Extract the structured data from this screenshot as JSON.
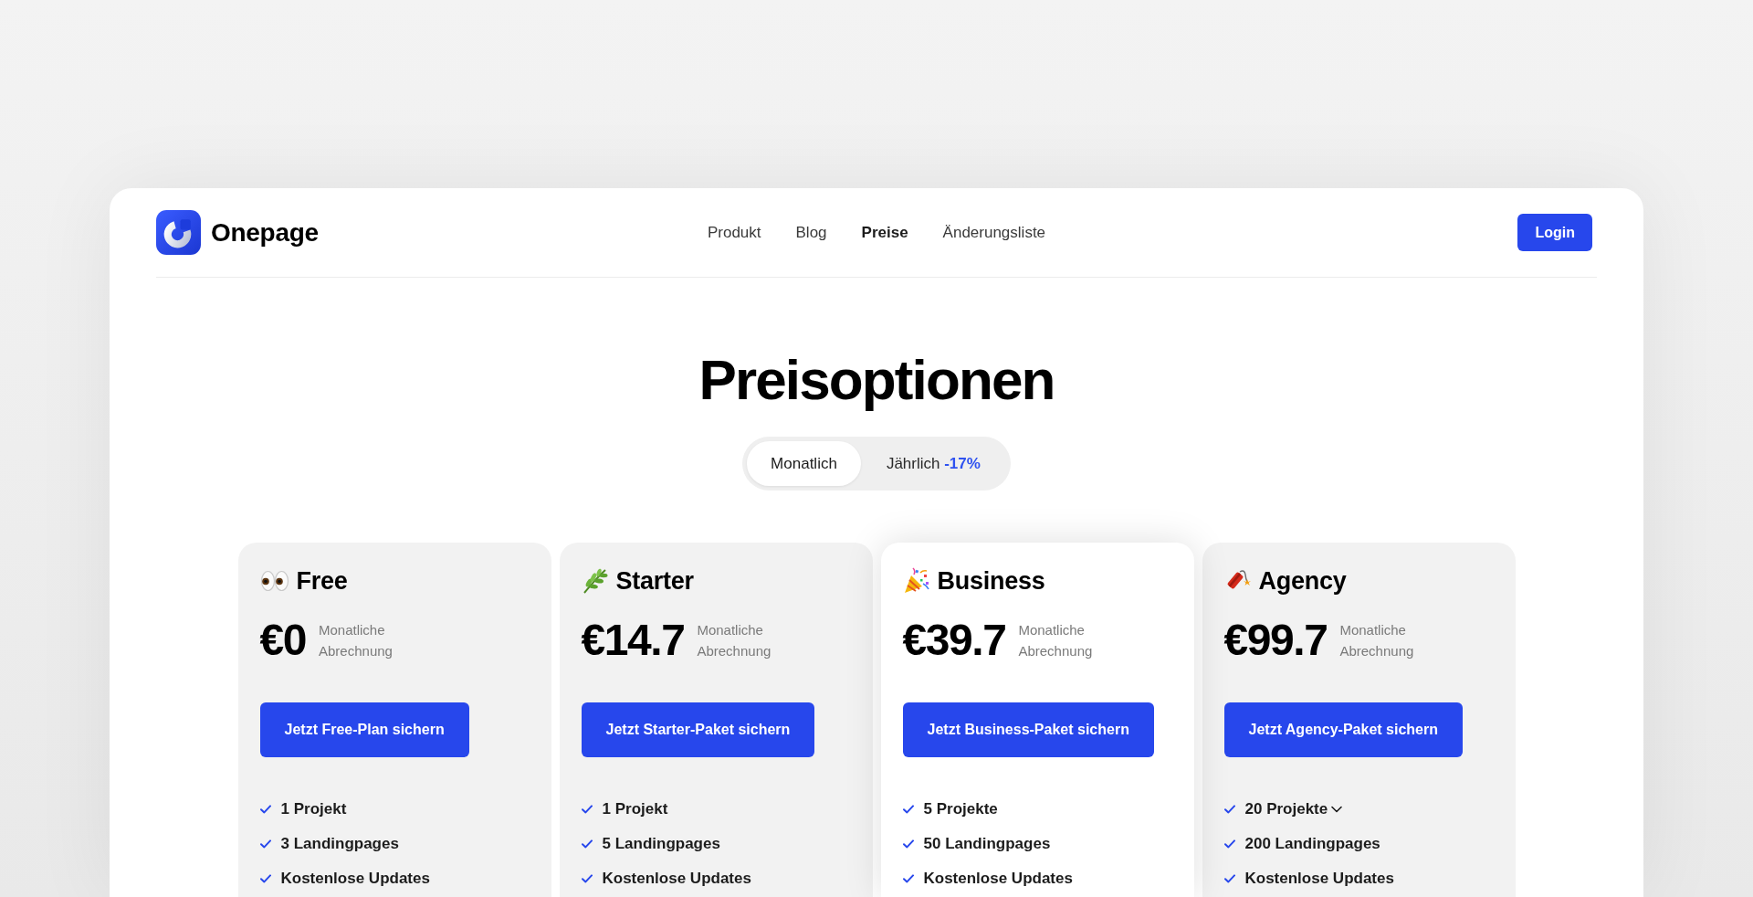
{
  "brand": {
    "name": "Onepage"
  },
  "nav": [
    {
      "label": "Produkt",
      "selected": false
    },
    {
      "label": "Blog",
      "selected": false
    },
    {
      "label": "Preise",
      "selected": true
    },
    {
      "label": "Änderungsliste",
      "selected": false
    }
  ],
  "login_button": "Login",
  "title": "Preisoptionen",
  "billing_toggle": [
    {
      "label": "Monatlich",
      "selected": true
    },
    {
      "label": "Jährlich",
      "discount": "-17%",
      "selected": false
    }
  ],
  "plans": [
    {
      "name": "Free",
      "price": "€0",
      "billing_note": "Monatliche Abrechnung",
      "button": "Jetzt Free-Plan sichern",
      "highlighted": false,
      "features": [
        {
          "text": "1 Projekt",
          "kind": "plain"
        },
        {
          "text": "3 Landingpages",
          "kind": "plain"
        },
        {
          "text": "Kostenlose Updates",
          "kind": "plain"
        }
      ]
    },
    {
      "name": "Starter",
      "price": "€14.7",
      "billing_note": "Monatliche Abrechnung",
      "button": "Jetzt Starter-Paket sichern",
      "highlighted": false,
      "features": [
        {
          "text": "1 Projekt",
          "kind": "plain"
        },
        {
          "text": "5 Landingpages",
          "kind": "plain"
        },
        {
          "text": "Kostenlose Updates",
          "kind": "plain"
        }
      ]
    },
    {
      "name": "Business",
      "price": "€39.7",
      "billing_note": "Monatliche Abrechnung",
      "button": "Jetzt Business-Paket sichern",
      "highlighted": true,
      "features": [
        {
          "text": "5 Projekte",
          "kind": "plain"
        },
        {
          "text": "50 Landingpages",
          "kind": "plain"
        },
        {
          "text": "Kostenlose Updates",
          "kind": "plain"
        }
      ]
    },
    {
      "name": "Agency",
      "price": "€99.7",
      "billing_note": "Monatliche Abrechnung",
      "button": "Jetzt Agency-Paket sichern",
      "highlighted": false,
      "features": [
        {
          "text": "20 Projekte",
          "kind": "dropdown"
        },
        {
          "text": "200 Landingpages",
          "kind": "plain"
        },
        {
          "text": "Kostenlose Updates",
          "kind": "plain"
        }
      ]
    }
  ]
}
